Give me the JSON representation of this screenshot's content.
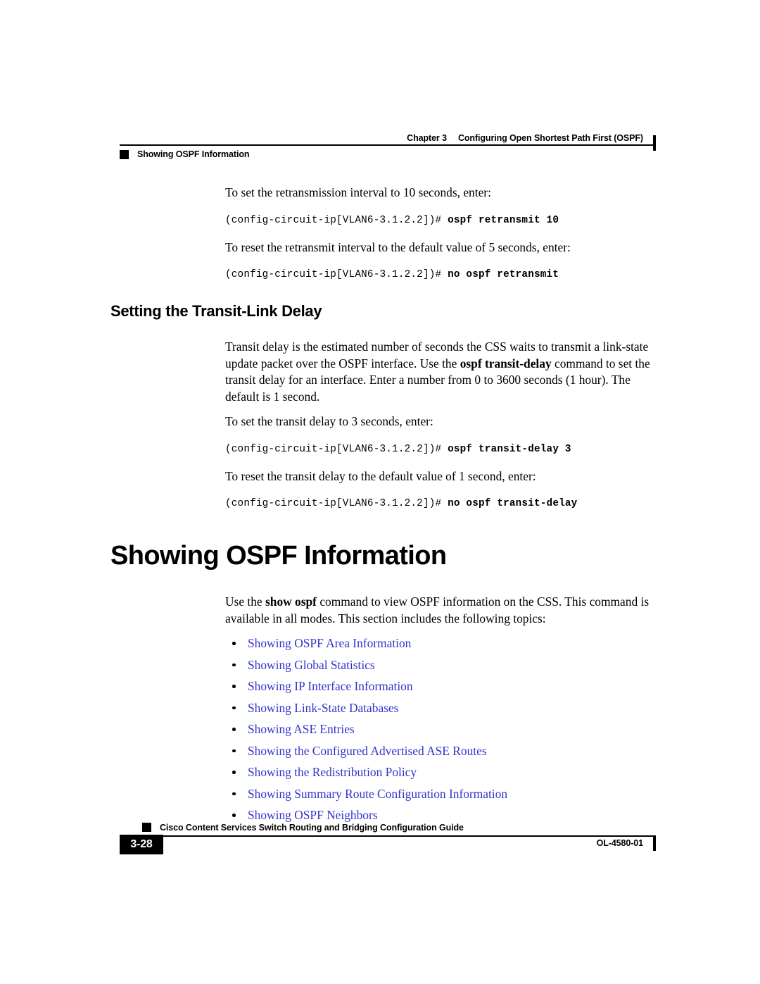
{
  "header": {
    "chapter_number": "Chapter 3",
    "chapter_title": "Configuring Open Shortest Path First (OSPF)",
    "running_subtitle": "Showing OSPF Information"
  },
  "content": {
    "intro_retransmit": {
      "set_text": "To set the retransmission interval to 10 seconds, enter:",
      "set_code_prompt": "(config-circuit-ip[VLAN6-3.1.2.2])# ",
      "set_code_command": "ospf retransmit 10",
      "reset_text": "To reset the retransmit interval to the default value of 5 seconds, enter:",
      "reset_code_prompt": "(config-circuit-ip[VLAN6-3.1.2.2])# ",
      "reset_code_command": "no ospf retransmit"
    },
    "transit_section": {
      "heading": "Setting the Transit-Link Delay",
      "para_part1": "Transit delay is the estimated number of seconds the CSS waits to transmit a link-state update packet over the OSPF interface. Use the ",
      "para_command": "ospf transit-delay",
      "para_part2": " command to set the transit delay for an interface. Enter a number from 0 to 3600 seconds (1 hour). The default is 1 second.",
      "set_text": "To set the transit delay to 3 seconds, enter:",
      "set_code_prompt": "(config-circuit-ip[VLAN6-3.1.2.2])# ",
      "set_code_command": "ospf transit-delay 3",
      "reset_text": "To reset the transit delay to the default value of 1 second, enter:",
      "reset_code_prompt": "(config-circuit-ip[VLAN6-3.1.2.2])# ",
      "reset_code_command": "no ospf transit-delay"
    },
    "showing_section": {
      "heading": "Showing OSPF Information",
      "para_part1": "Use the ",
      "para_command": "show ospf",
      "para_part2": " command to view OSPF information on the CSS. This command is available in all modes. This section includes the following topics:",
      "link_color": "#3333CC",
      "topics": [
        {
          "label": "Showing OSPF Area Information"
        },
        {
          "label": "Showing Global Statistics"
        },
        {
          "label": "Showing IP Interface Information"
        },
        {
          "label": "Showing Link-State Databases"
        },
        {
          "label": "Showing ASE Entries"
        },
        {
          "label": "Showing the Configured Advertised ASE Routes"
        },
        {
          "label": "Showing the Redistribution Policy"
        },
        {
          "label": "Showing Summary Route Configuration Information"
        },
        {
          "label": "Showing OSPF Neighbors"
        }
      ]
    }
  },
  "footer": {
    "guide_title": "Cisco Content Services Switch Routing and Bridging Configuration Guide",
    "page_number": "3-28",
    "document_id": "OL-4580-01"
  }
}
